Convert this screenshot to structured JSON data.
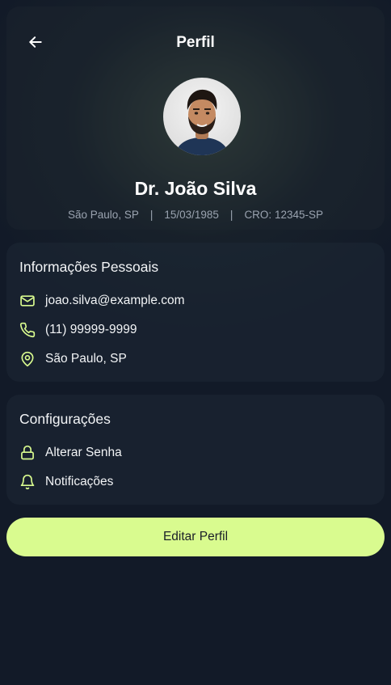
{
  "header": {
    "title": "Perfil",
    "back_icon": "arrow-left-icon"
  },
  "profile": {
    "name": "Dr. João Silva",
    "city": "São Paulo, SP",
    "birth_date": "15/03/1985",
    "cro": "CRO: 12345-SP",
    "separator": "|"
  },
  "personal_info": {
    "title": "Informações Pessoais",
    "email": "joao.silva@example.com",
    "phone": "(11) 99999-9999",
    "location": "São Paulo, SP"
  },
  "settings": {
    "title": "Configurações",
    "change_password": "Alterar Senha",
    "notifications": "Notificações"
  },
  "actions": {
    "edit_profile": "Editar Perfil"
  },
  "colors": {
    "accent": "#d9fb8f",
    "background": "#121a28"
  }
}
